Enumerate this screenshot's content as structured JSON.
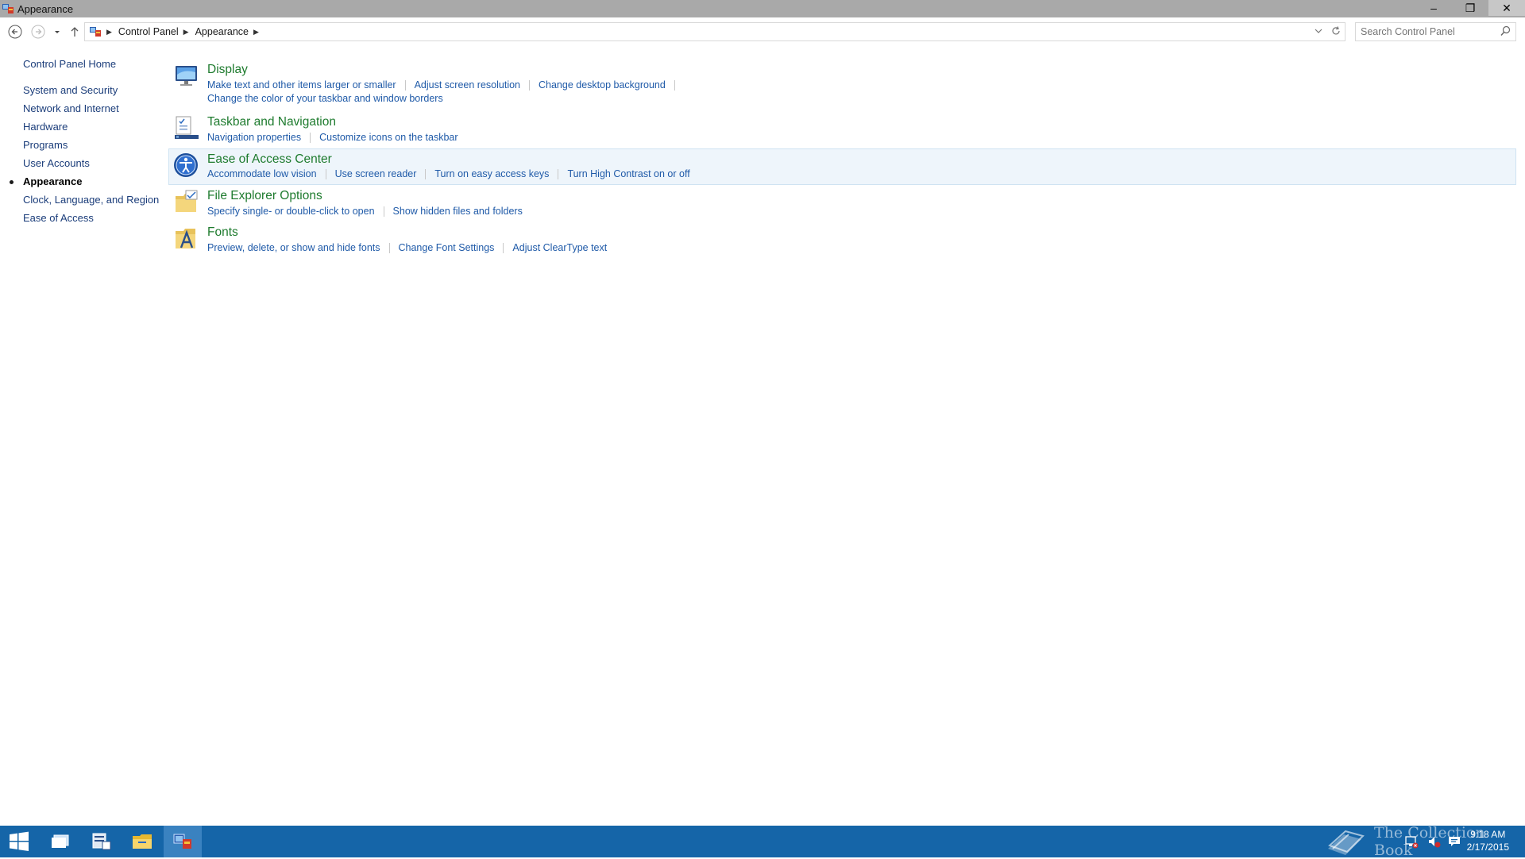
{
  "window": {
    "title": "Appearance",
    "controls": {
      "minimize": "–",
      "restore": "❐",
      "close": "✕"
    }
  },
  "nav": {
    "back_icon": "back-arrow-icon",
    "forward_icon": "forward-arrow-icon",
    "recent_icon": "chevron-down-icon",
    "up_icon": "up-arrow-icon"
  },
  "breadcrumb": {
    "items": [
      "Control Panel",
      "Appearance"
    ],
    "separator": "▶"
  },
  "search": {
    "placeholder": "Search Control Panel"
  },
  "leftpane": {
    "home": "Control Panel Home",
    "categories": [
      "System and Security",
      "Network and Internet",
      "Hardware",
      "Programs",
      "User Accounts",
      "Appearance",
      "Clock, Language, and Region",
      "Ease of Access"
    ],
    "active_index": 5
  },
  "groups": [
    {
      "title": "Display",
      "icon": "display-monitor-icon",
      "links": [
        "Make text and other items larger or smaller",
        "Adjust screen resolution",
        "Change desktop background"
      ],
      "links2": [
        "Change the color of your taskbar and window borders"
      ]
    },
    {
      "title": "Taskbar and Navigation",
      "icon": "taskbar-icon",
      "links": [
        "Navigation properties",
        "Customize icons on the taskbar"
      ]
    },
    {
      "title": "Ease of Access Center",
      "icon": "ease-of-access-icon",
      "links": [
        "Accommodate low vision",
        "Use screen reader",
        "Turn on easy access keys",
        "Turn High Contrast on or off"
      ]
    },
    {
      "title": "File Explorer Options",
      "icon": "folder-options-icon",
      "links": [
        "Specify single- or double-click to open",
        "Show hidden files and folders"
      ]
    },
    {
      "title": "Fonts",
      "icon": "fonts-folder-icon",
      "links": [
        "Preview, delete, or show and hide fonts",
        "Change Font Settings",
        "Adjust ClearType text"
      ]
    }
  ],
  "taskbar": {
    "watermark": "The Collection Book",
    "time": "9:18 AM",
    "date": "2/17/2015"
  },
  "colors": {
    "titlebar": "#a9a9a9",
    "taskbar": "#1565a8",
    "link": "#1f5aa8",
    "group_title": "#1e7b2e",
    "highlight": "#eef5fb"
  }
}
